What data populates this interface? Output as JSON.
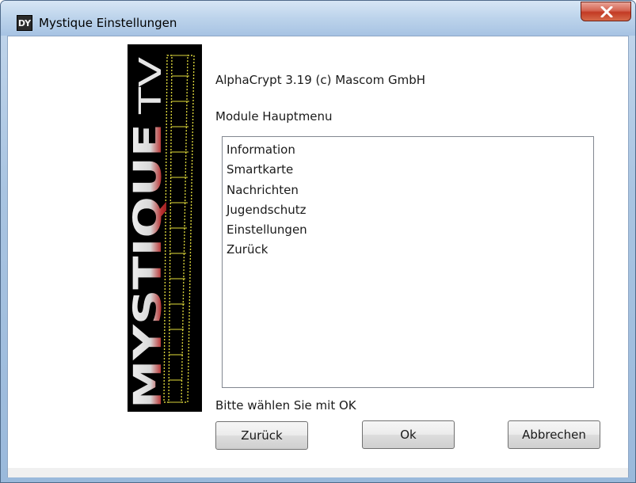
{
  "window": {
    "title": "Mystique Einstellungen",
    "icon_text": "DY",
    "close_symbol": "×"
  },
  "logo": {
    "brand_main": "MYSTIQUE",
    "brand_suffix": "TV",
    "colors": {
      "background": "#000000",
      "letters": "#f0f0f0",
      "lower_letters": "#b21f1f",
      "filmstrip": "#e6e03a"
    }
  },
  "header": {
    "version_text": "AlphaCrypt 3.19 (c) Mascom GmbH",
    "menu_title": "Module Hauptmenu"
  },
  "menu": {
    "items": [
      "Information",
      "Smartkarte",
      "Nachrichten",
      "Jugendschutz",
      "Einstellungen",
      "Zurück"
    ]
  },
  "footer": {
    "hint": "Bitte wählen Sie mit OK"
  },
  "buttons": {
    "back_label": "Zurück",
    "ok_label": "Ok",
    "cancel_label": "Abbrechen"
  }
}
